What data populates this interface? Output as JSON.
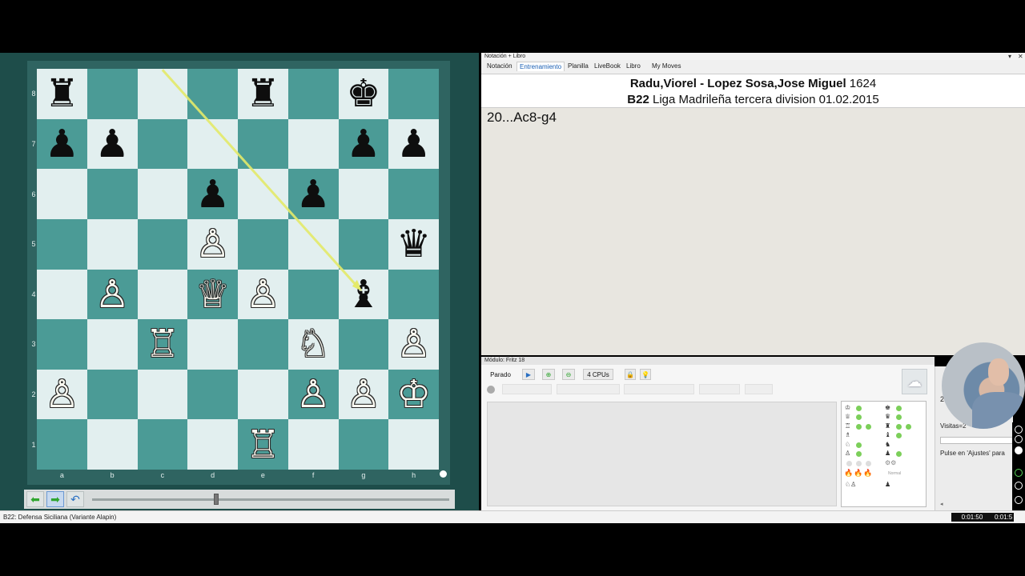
{
  "board": {
    "ranks": [
      "8",
      "7",
      "6",
      "5",
      "4",
      "3",
      "2",
      "1"
    ],
    "files": [
      "a",
      "b",
      "c",
      "d",
      "e",
      "f",
      "g",
      "h"
    ],
    "pieces": [
      {
        "sq": "a8",
        "glyph": "♜",
        "color": "b"
      },
      {
        "sq": "e8",
        "glyph": "♜",
        "color": "b"
      },
      {
        "sq": "g8",
        "glyph": "♚",
        "color": "b"
      },
      {
        "sq": "a7",
        "glyph": "♟",
        "color": "b"
      },
      {
        "sq": "b7",
        "glyph": "♟",
        "color": "b"
      },
      {
        "sq": "g7",
        "glyph": "♟",
        "color": "b"
      },
      {
        "sq": "h7",
        "glyph": "♟",
        "color": "b"
      },
      {
        "sq": "d6",
        "glyph": "♟",
        "color": "b"
      },
      {
        "sq": "f6",
        "glyph": "♟",
        "color": "b"
      },
      {
        "sq": "d5",
        "glyph": "♙",
        "color": "w"
      },
      {
        "sq": "h5",
        "glyph": "♛",
        "color": "b"
      },
      {
        "sq": "b4",
        "glyph": "♙",
        "color": "w"
      },
      {
        "sq": "d4",
        "glyph": "♕",
        "color": "w"
      },
      {
        "sq": "e4",
        "glyph": "♙",
        "color": "w"
      },
      {
        "sq": "g4",
        "glyph": "♝",
        "color": "b"
      },
      {
        "sq": "c3",
        "glyph": "♖",
        "color": "w"
      },
      {
        "sq": "f3",
        "glyph": "♘",
        "color": "w"
      },
      {
        "sq": "h3",
        "glyph": "♙",
        "color": "w"
      },
      {
        "sq": "a2",
        "glyph": "♙",
        "color": "w"
      },
      {
        "sq": "f2",
        "glyph": "♙",
        "color": "w"
      },
      {
        "sq": "g2",
        "glyph": "♙",
        "color": "w"
      },
      {
        "sq": "h2",
        "glyph": "♔",
        "color": "w"
      },
      {
        "sq": "e1",
        "glyph": "♖",
        "color": "w"
      }
    ],
    "arrow": {
      "from": "c8",
      "to": "g4",
      "color": "#e4ea6a"
    }
  },
  "nav": {
    "back_icon": "arrow-left-icon",
    "forward_icon": "arrow-right-icon",
    "undo_icon": "undo-icon"
  },
  "status": {
    "opening": "B22: Defensa Siciliana (Variante Alapin)",
    "timer1": "0:01:50",
    "timer2": "0:01:5"
  },
  "notation": {
    "title": "Notación + Libro",
    "tabs": [
      "Notación",
      "Entrenamiento",
      "Planilla",
      "LiveBook",
      "Libro",
      "My Moves"
    ],
    "active_tab": 1,
    "white_player": "Radu,Viorel",
    "separator": " - ",
    "black_player": "Lopez Sosa,Jose Miguel",
    "black_elo": "1624",
    "eco": "B22",
    "event": "Liga Madrileña tercera division 01.02.2015",
    "move": "20...Ac8-g4"
  },
  "engine": {
    "title": "Módulo: Fritz 18",
    "stop_label": "Parado",
    "cpus_label": "4 CPUs",
    "normal_label": "Normal"
  },
  "stats": {
    "count": "2",
    "visits": "Visitas=2",
    "hint": "Pulse en 'Ajustes' para"
  },
  "colors": {
    "light_square": "#e2efef",
    "dark_square": "#4b9b96",
    "board_bg": "#1e4d4a",
    "active_tab": "#1a5fb4"
  }
}
